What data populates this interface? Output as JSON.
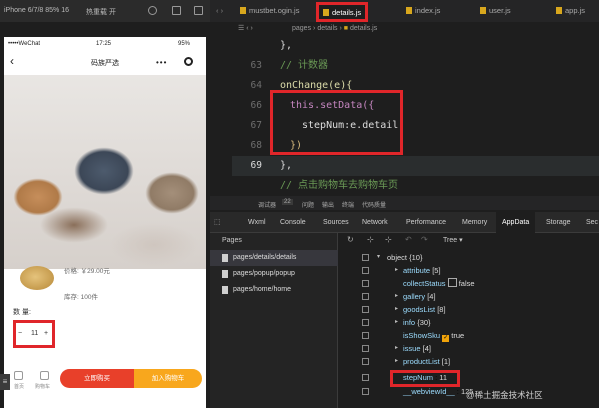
{
  "simulator": {
    "device_label": "iPhone 6/7/8 85% 16",
    "hot_reload_label": "热重载 开"
  },
  "phone": {
    "status_carrier": "WeChat",
    "status_time": "17:25",
    "status_battery": "95%",
    "nav_title": "码族严选",
    "price_label": "价格: ￥29.00元",
    "stock_label": "库存: 100件",
    "quantity_label": "数 量:",
    "stepper": {
      "minus": "−",
      "value": "11",
      "plus": "+"
    },
    "bottom": {
      "home_label": "首页",
      "cart_label": "购物车",
      "buy_now": "立即购买",
      "add_to_cart": "加入购物车"
    }
  },
  "editor": {
    "tabs": [
      "mustbet.ogin.js",
      "details.js",
      "index.js",
      "user.js",
      "app.js"
    ],
    "active_tab": "details.js",
    "breadcrumb": [
      "pages",
      "details",
      "details.js"
    ],
    "lines": [
      {
        "num": "",
        "text": "},",
        "indent": 0
      },
      {
        "num": "63",
        "text": "// 计数器",
        "indent": 0,
        "kind": "comment"
      },
      {
        "num": "64",
        "text": "onChange(e){",
        "indent": 0,
        "kind": "fn"
      },
      {
        "num": "66",
        "text": "this.setData({",
        "indent": 1,
        "kind": "call"
      },
      {
        "num": "67",
        "text": "stepNum:e.detail",
        "indent": 2,
        "kind": "plain"
      },
      {
        "num": "68",
        "text": "})",
        "indent": 1,
        "kind": "plain"
      },
      {
        "num": "69",
        "text": "},",
        "indent": 0,
        "kind": "plain"
      },
      {
        "num": "",
        "text": "// 点击购物车去购物车页",
        "indent": 0,
        "kind": "comment"
      }
    ]
  },
  "devtools": {
    "label_strip": [
      "调试器",
      "22",
      "问题",
      "输出",
      "终端",
      "代码质量"
    ],
    "tabs": [
      "Wxml",
      "Console",
      "Sources",
      "Network",
      "Performance",
      "Memory",
      "AppData",
      "Storage",
      "Sec"
    ],
    "active_tab": "AppData",
    "pages_header": "Pages",
    "pages": [
      "pages/details/details",
      "pages/popup/popup",
      "pages/home/home"
    ],
    "tree_view_label": "Tree",
    "tree": [
      {
        "key": "object",
        "value": "{10}",
        "level": 0,
        "arrow": "▾"
      },
      {
        "key": "attribute",
        "value": "[5]",
        "level": 1,
        "arrow": "▸"
      },
      {
        "key": "collectStatus",
        "value": "false",
        "level": 1,
        "arrow": "",
        "bool": false
      },
      {
        "key": "gallery",
        "value": "[4]",
        "level": 1,
        "arrow": "▸"
      },
      {
        "key": "goodsList",
        "value": "[8]",
        "level": 1,
        "arrow": "▸"
      },
      {
        "key": "info",
        "value": "{30}",
        "level": 1,
        "arrow": "▸"
      },
      {
        "key": "isShowSku",
        "value": "true",
        "level": 1,
        "arrow": "",
        "bool": true
      },
      {
        "key": "issue",
        "value": "[4]",
        "level": 1,
        "arrow": "▸"
      },
      {
        "key": "productList",
        "value": "[1]",
        "level": 1,
        "arrow": "▸"
      },
      {
        "key": "stepNum",
        "value": "11",
        "level": 1,
        "arrow": ""
      },
      {
        "key": "__webviewId__",
        "value": "125",
        "level": 1,
        "arrow": ""
      }
    ]
  },
  "watermark": "@稀土掘金技术社区",
  "colors": {
    "highlight_red": "#e0262a",
    "buy_red": "#e8402a",
    "cart_orange": "#f8a71d",
    "editor_bg": "#1e1e1e"
  }
}
